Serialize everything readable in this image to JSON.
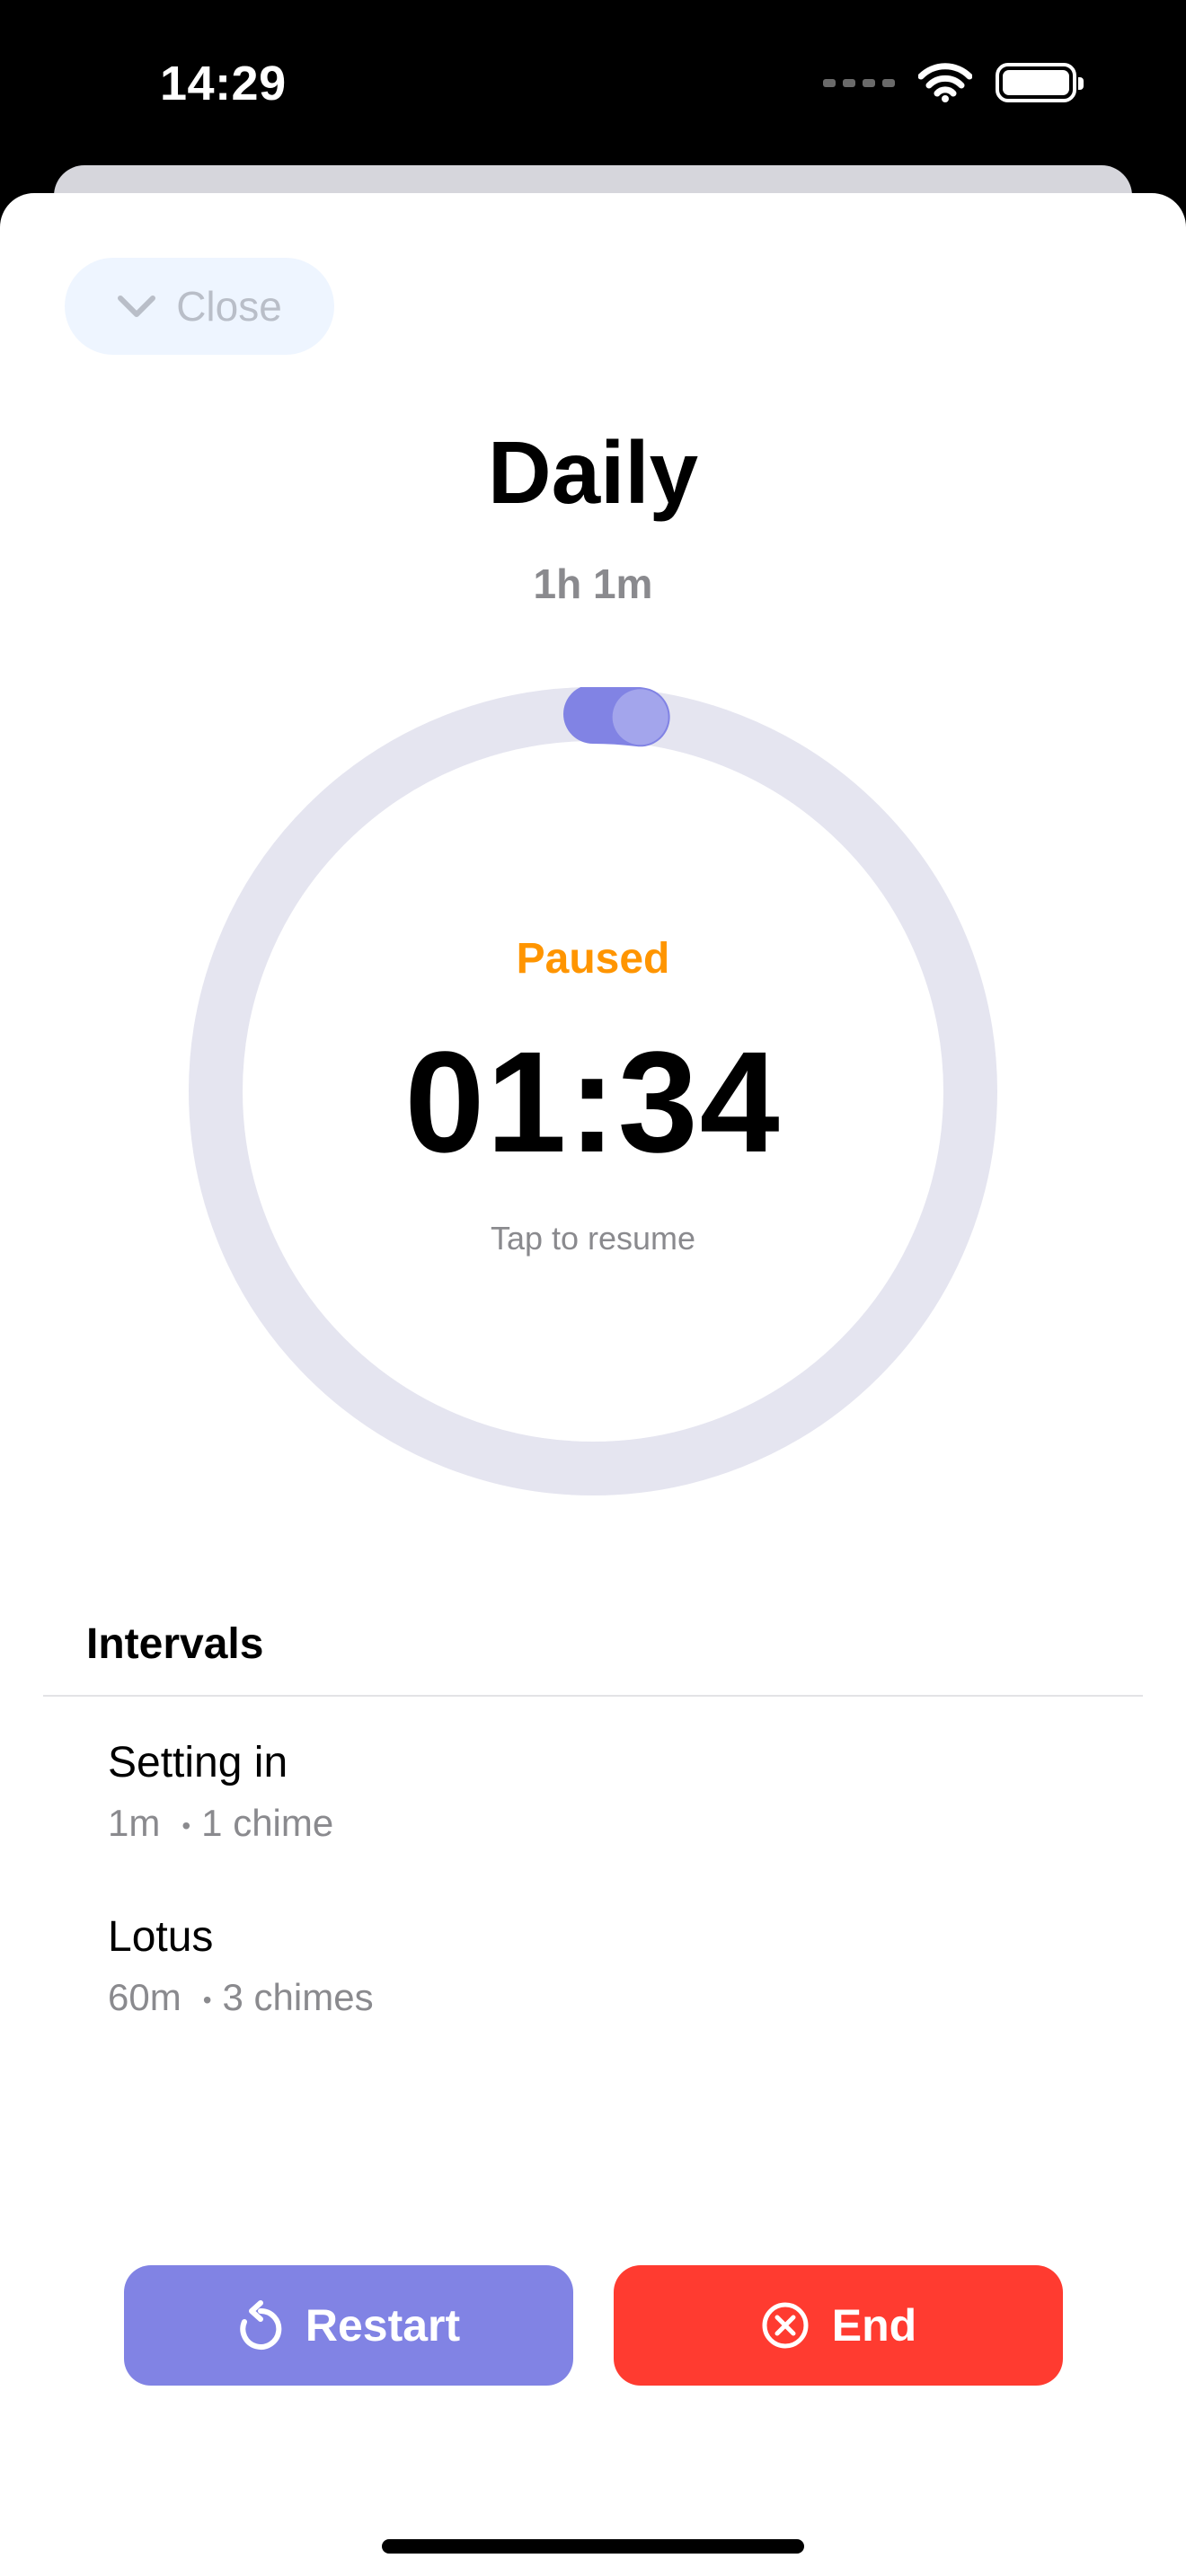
{
  "status_bar": {
    "time": "14:29"
  },
  "header": {
    "close_label": "Close"
  },
  "session": {
    "title": "Daily",
    "duration": "1h 1m"
  },
  "timer": {
    "state": "Paused",
    "remaining": "01:34",
    "hint": "Tap to resume",
    "progress": 0.02
  },
  "intervals": {
    "heading": "Intervals",
    "items": [
      {
        "name": "Setting in",
        "duration": "1m",
        "dot": "•",
        "chimes": "1 chime"
      },
      {
        "name": "Lotus",
        "duration": "60m",
        "dot": "•",
        "chimes": "3 chimes"
      }
    ]
  },
  "actions": {
    "restart_label": "Restart",
    "end_label": "End"
  },
  "colors": {
    "accent": "#8183E4",
    "paused": "#FF9500",
    "destructive": "#FF3B30",
    "track": "#E5E5F0"
  },
  "icons": {
    "close": "chevron-down-icon",
    "restart": "counterclockwise-arrow-icon",
    "end": "x-circle-icon"
  }
}
